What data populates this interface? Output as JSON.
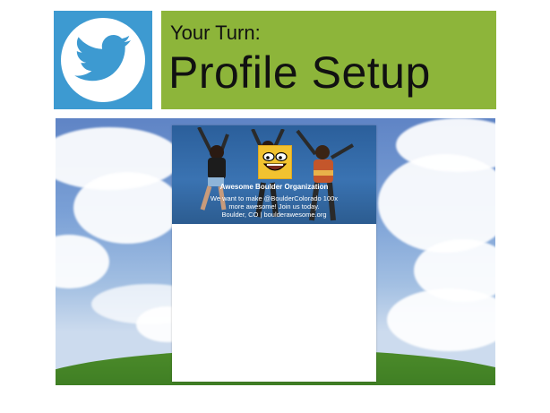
{
  "header": {
    "subtitle": "Your Turn:",
    "title": "Profile Setup",
    "logo_icon": "twitter-bird-icon",
    "logo_bg": "#3d9ad1",
    "title_bg": "#8db53a"
  },
  "profile_card": {
    "name": "Awesome Boulder Organization",
    "bio_line_1": "We want to make @BoulderColorado 100x",
    "bio_line_2": "more awesome! Join us today.",
    "location_line": "Boulder, CO | boulderawesome.org",
    "avatar_icon": "awesome-face-icon",
    "avatar_color": "#f2c230"
  }
}
